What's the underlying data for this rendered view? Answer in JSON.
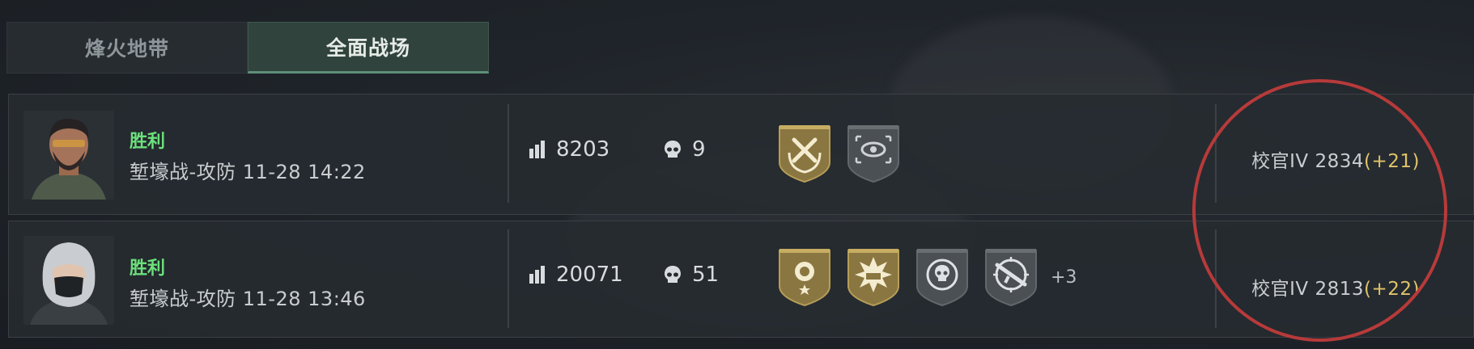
{
  "tabs": [
    {
      "label": "烽火地带",
      "active": false
    },
    {
      "label": "全面战场",
      "active": true
    }
  ],
  "matches": [
    {
      "result": "胜利",
      "mode_time": "堑壕战-攻防 11-28 14:22",
      "score": "8203",
      "kills": "9",
      "badges": [
        "tools-laurel-badge",
        "eye-target-badge"
      ],
      "extra_badges": "",
      "rank": "校官IV 2834",
      "rank_delta": "(+21)"
    },
    {
      "result": "胜利",
      "mode_time": "堑壕战-攻防 11-28 13:46",
      "score": "20071",
      "kills": "51",
      "badges": [
        "rose-star-badge",
        "explosion-tank-badge",
        "skull-crosshair-badge",
        "rifle-crosshair-badge"
      ],
      "extra_badges": "+3",
      "rank": "校官IV 2813",
      "rank_delta": "(+22)"
    }
  ],
  "colors": {
    "victory": "#6ce07c",
    "delta": "#e0c36a",
    "annotation": "#b73a3a",
    "active_tab": "#30433d"
  }
}
